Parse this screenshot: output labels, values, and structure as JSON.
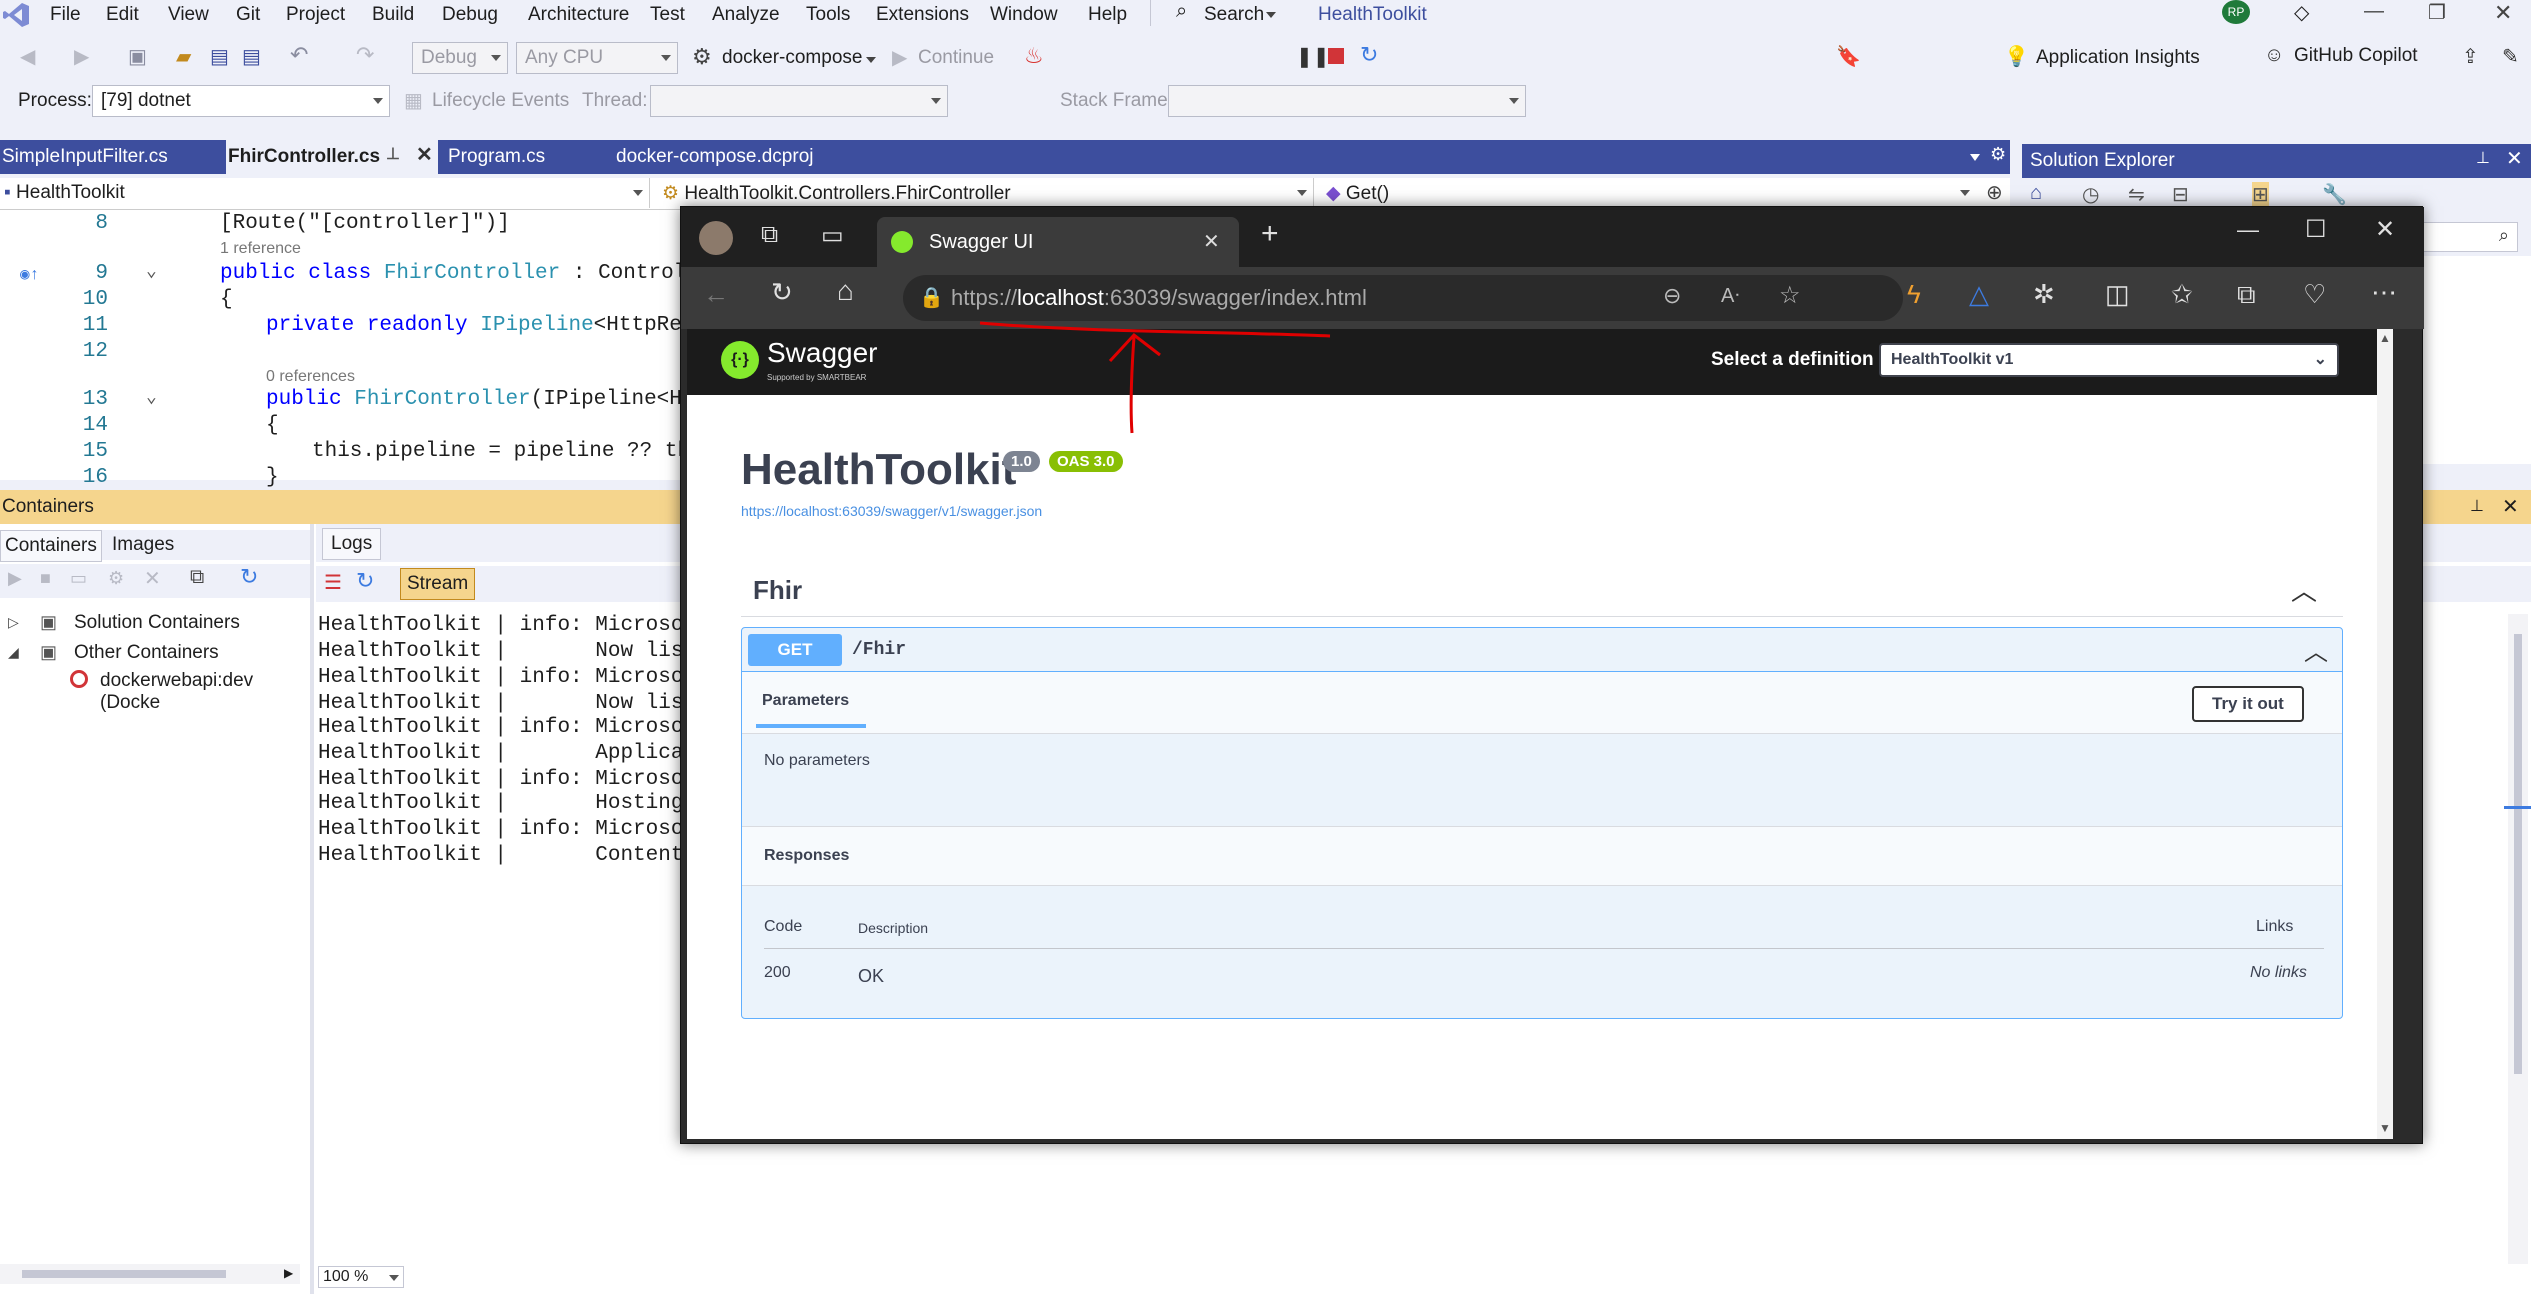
{
  "menu": {
    "items": [
      "File",
      "Edit",
      "View",
      "Git",
      "Project",
      "Build",
      "Debug",
      "Architecture",
      "Test",
      "Analyze",
      "Tools",
      "Extensions",
      "Window",
      "Help"
    ],
    "search": "Search",
    "solution_title": "HealthToolkit",
    "avatar": "RP"
  },
  "toolbar": {
    "config": "Debug",
    "platform": "Any CPU",
    "launch_profile": "docker-compose",
    "continue": "Continue",
    "app_insights": "Application Insights",
    "copilot": "GitHub Copilot"
  },
  "toolbar2": {
    "process_label": "Process:",
    "process_value": "[79] dotnet",
    "lifecycle": "Lifecycle Events",
    "thread_label": "Thread:",
    "stack_label": "Stack Frame:"
  },
  "doc_tabs": [
    "SimpleInputFilter.cs",
    "FhirController.cs",
    "Program.cs",
    "docker-compose.dcproj"
  ],
  "navbar": {
    "project": "HealthToolkit",
    "type": "HealthToolkit.Controllers.FhirController",
    "member": "Get()"
  },
  "code": {
    "line_numbers": [
      "8",
      "9",
      "10",
      "11",
      "12",
      "13",
      "14",
      "15",
      "16"
    ],
    "l8": "[Route(\"[controller]\")]",
    "ref1": "1 reference",
    "l9_kw": "public class ",
    "l9_type": "FhirController",
    "l9_rest": " : Controller",
    "l10": "{",
    "l11_kw": "private readonly ",
    "l11_type": "IPipeline",
    "l11_rest": "<HttpReque",
    "ref0": "0 references",
    "l13_kw": "public ",
    "l13_type": "FhirController",
    "l13_rest": "(IPipeline<Http",
    "l14": "{",
    "l15": "this.pipeline = pipeline ?? thro",
    "l16": "}"
  },
  "solution_explorer": {
    "title": "Solution Explorer"
  },
  "containers": {
    "title": "Containers",
    "tabs": [
      "Containers",
      "Images"
    ],
    "tree": [
      "Solution Containers",
      "Other Containers",
      "dockerwebapi:dev (Docke"
    ],
    "logs_tab": "Logs",
    "stream": "Stream",
    "zoom": "100 %",
    "log_lines": [
      "HealthToolkit | info: Microsoft.",
      "HealthToolkit |       Now listen",
      "HealthToolkit | info: Microsoft.",
      "HealthToolkit |       Now listen",
      "HealthToolkit | info: Microsoft.",
      "HealthToolkit |       Applicatio",
      "HealthToolkit | info: Microsoft.",
      "HealthToolkit |       Hosting en",
      "HealthToolkit | info: Microsoft.",
      "HealthToolkit |       Content ro"
    ]
  },
  "browser": {
    "tab_title": "Swagger UI",
    "url_prefix": "https://",
    "url_host": "localhost",
    "url_rest": ":63039/swagger/index.html"
  },
  "swagger": {
    "logo": "Swagger",
    "logo_sub": "Supported by SMARTBEAR",
    "select_label": "Select a definition",
    "definition": "HealthToolkit v1",
    "api_title": "HealthToolkit",
    "version": "1.0",
    "oas": "OAS 3.0",
    "spec_url": "https://localhost:63039/swagger/v1/swagger.json",
    "section": "Fhir",
    "method": "GET",
    "path": "/Fhir",
    "params_tab": "Parameters",
    "try_button": "Try it out",
    "no_params": "No parameters",
    "responses": "Responses",
    "col_code": "Code",
    "col_desc": "Description",
    "col_links": "Links",
    "resp_code": "200",
    "resp_desc": "OK",
    "resp_links": "No links"
  },
  "colors": {
    "vs_accent": "#3d4e9e",
    "containers_header": "#f5d58d",
    "swagger_get": "#61affe",
    "swagger_green": "#89bf04",
    "annotation": "#e00000"
  }
}
